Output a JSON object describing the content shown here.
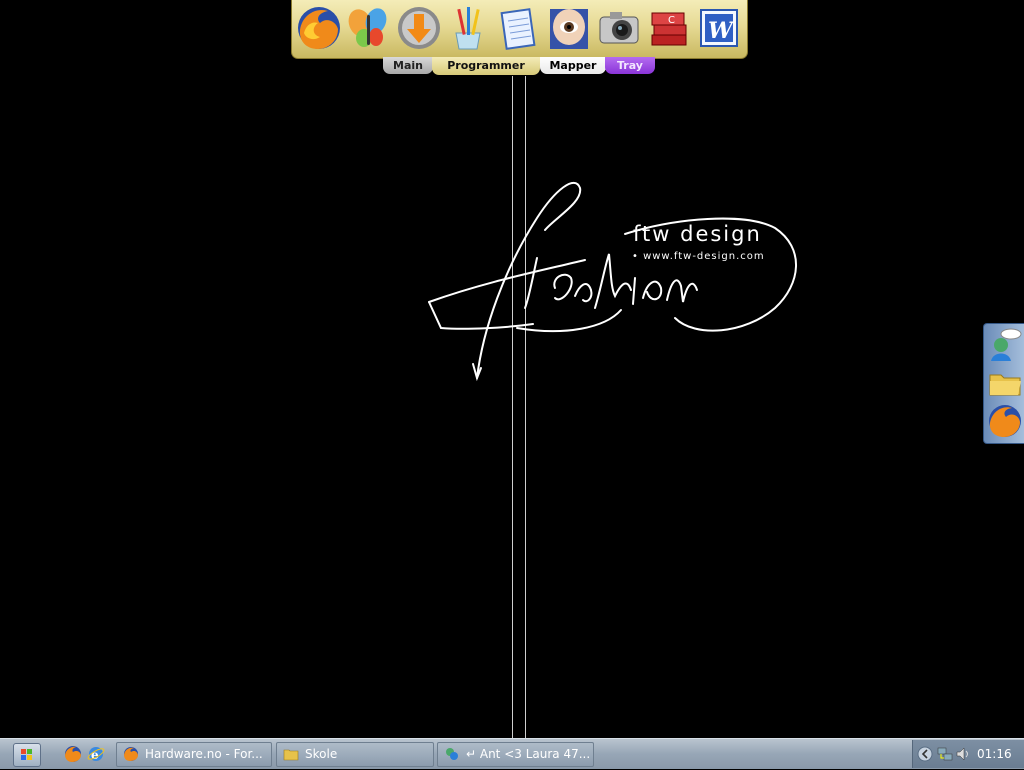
{
  "dock": {
    "icons": [
      "firefox-icon",
      "msn-butterfly-icon",
      "download-arrow-icon",
      "paint-brushes-icon",
      "notepad-icon",
      "eye-viewer-icon",
      "camera-icon",
      "book-stack-icon",
      "word-icon"
    ],
    "tabs": {
      "main": "Main",
      "programmer": "Programmer",
      "mapper": "Mapper",
      "tray": "Tray"
    }
  },
  "wallpaper": {
    "script_text": "fashion",
    "brand": "ftw design",
    "url": "• www.ftw-design.com"
  },
  "side_dock": {
    "icons": [
      "msn-messenger-icon",
      "folder-icon",
      "firefox-icon"
    ]
  },
  "taskbar": {
    "quick_launch": [
      "firefox-icon",
      "ie-icon"
    ],
    "tasks": [
      {
        "label": "Hardware.no - For...",
        "icon": "firefox-icon"
      },
      {
        "label": "Skole",
        "icon": "folder-icon"
      },
      {
        "label": "↵ Ant <3 Laura 47...",
        "icon": "msn-icon"
      }
    ],
    "tray": {
      "clock": "01:16"
    }
  },
  "colors": {
    "dock_gold": "#e6da94",
    "tray_tab": "#8a34d8",
    "taskbar": "#97a6b6",
    "background": "#000000"
  }
}
